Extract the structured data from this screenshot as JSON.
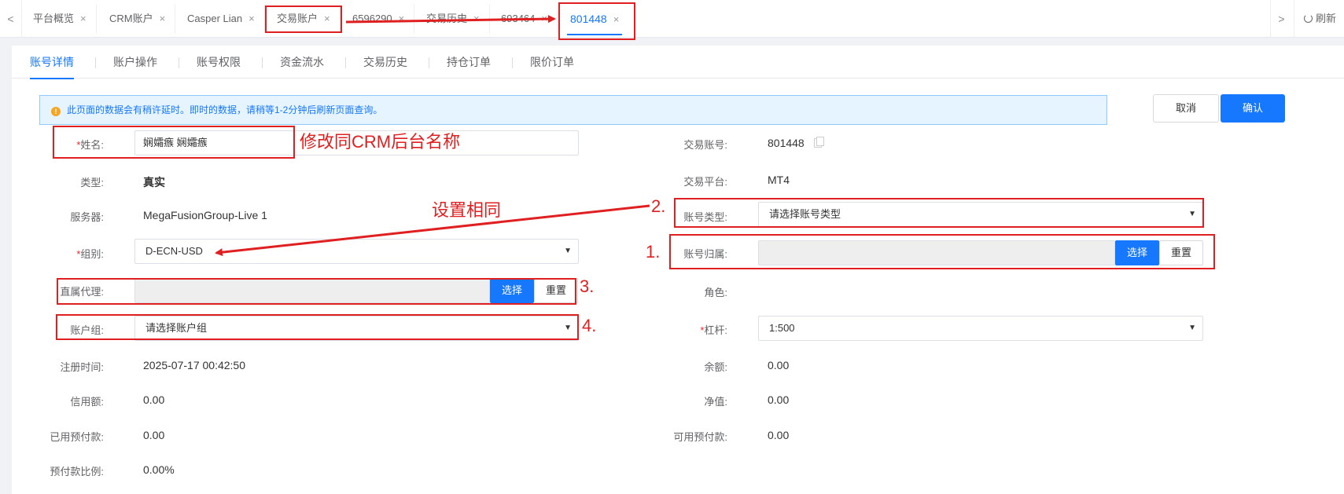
{
  "tabs": [
    {
      "label": "平台概览"
    },
    {
      "label": "CRM账户"
    },
    {
      "label": "Casper Lian"
    },
    {
      "label": "交易账户"
    },
    {
      "label": "6596290"
    },
    {
      "label": "交易历史"
    },
    {
      "label": "693464"
    },
    {
      "label": "801448"
    }
  ],
  "tabbar": {
    "prev": "<",
    "next": ">",
    "refresh": "刷新",
    "close_glyph": "×"
  },
  "subtabs": [
    "账号详情",
    "账户操作",
    "账号权限",
    "资金流水",
    "交易历史",
    "持仓订单",
    "限价订单"
  ],
  "notice": "此页面的数据会有稍许延时。即时的数据，请稍等1-2分钟后刷新页面查询。",
  "buttons": {
    "cancel": "取消",
    "confirm": "确认",
    "select": "选择",
    "reset": "重置"
  },
  "form": {
    "name_label": "姓名:",
    "name_value": "娴孀瘯 娴孀瘯",
    "type_label": "类型:",
    "type_value": "真实",
    "server_label": "服务器:",
    "server_value": "MegaFusionGroup-Live 1",
    "group_label": "组别:",
    "group_value": "D-ECN-USD",
    "agent_label": "直属代理:",
    "account_group_label": "账户组:",
    "account_group_placeholder": "请选择账户组",
    "reg_time_label": "注册时间:",
    "reg_time_value": "2025-07-17 00:42:50",
    "credit_label": "信用额:",
    "credit_value": "0.00",
    "used_prepay_label": "已用预付款:",
    "used_prepay_value": "0.00",
    "prepay_ratio_label": "预付款比例:",
    "prepay_ratio_value": "0.00%",
    "trade_account_label": "交易账号:",
    "trade_account_value": "801448",
    "platform_label": "交易平台:",
    "platform_value": "MT4",
    "account_type_label": "账号类型:",
    "account_type_placeholder": "请选择账号类型",
    "account_owner_label": "账号归属:",
    "role_label": "角色:",
    "leverage_label": "杠杆:",
    "leverage_value": "1:500",
    "balance_label": "余额:",
    "balance_value": "0.00",
    "equity_label": "净值:",
    "equity_value": "0.00",
    "free_margin_label": "可用预付款:",
    "free_margin_value": "0.00"
  },
  "annotations": {
    "name_note": "修改同CRM后台名称",
    "same_note": "设置相同",
    "n1": "1.",
    "n2": "2.",
    "n3": "3.",
    "n4": "4."
  },
  "colors": {
    "accent": "#1677ff",
    "annotation": "#e02020"
  }
}
